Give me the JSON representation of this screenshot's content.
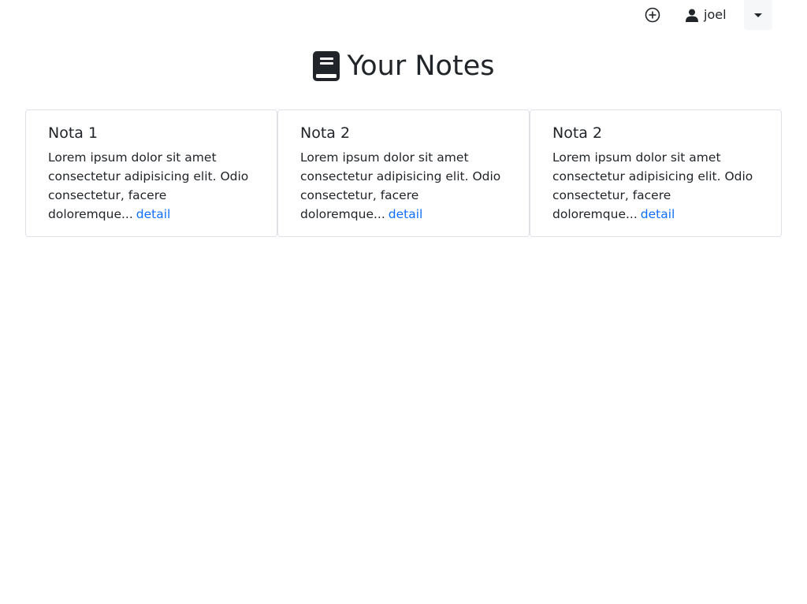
{
  "header": {
    "add_icon": "circle-plus-icon",
    "user_icon": "user-icon",
    "user_name": "joel",
    "dropdown_icon": "caret-down-icon"
  },
  "page": {
    "title": "Your Notes",
    "title_icon": "book-icon"
  },
  "notes": [
    {
      "title": "Nota 1",
      "excerpt": "Lorem ipsum dolor sit amet consectetur adipisicing elit. Odio consectetur, facere doloremque...",
      "link_label": "detail"
    },
    {
      "title": "Nota 2",
      "excerpt": "Lorem ipsum dolor sit amet consectetur adipisicing elit. Odio consectetur, facere doloremque...",
      "link_label": "detail"
    },
    {
      "title": "Nota 2",
      "excerpt": "Lorem ipsum dolor sit amet consectetur adipisicing elit. Odio consectetur, facere doloremque...",
      "link_label": "detail"
    }
  ],
  "colors": {
    "link": "#0d6efd",
    "text": "#212529",
    "border": "#dee2e6",
    "dropdown_bg": "#f6f7f8"
  }
}
